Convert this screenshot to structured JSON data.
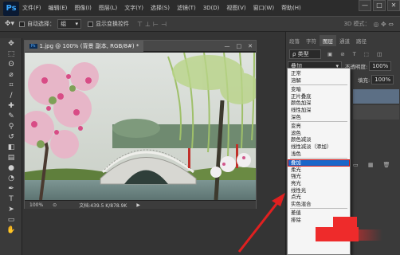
{
  "app": {
    "logo": "Ps"
  },
  "menu": [
    "文件(F)",
    "编辑(E)",
    "图像(I)",
    "图层(L)",
    "文字(Y)",
    "选择(S)",
    "滤镜(T)",
    "3D(D)",
    "视图(V)",
    "窗口(W)",
    "帮助(H)"
  ],
  "window_buttons": [
    "—",
    "□",
    "✕"
  ],
  "options": {
    "auto_select_label": "自动选择：",
    "auto_select_value": "组",
    "show_transform_label": "显示变换控件",
    "mode_3d": "3D 模式："
  },
  "document": {
    "tab_label": "1.jpg @ 100% (背景 副本, RGB/8#) *",
    "zoom": "100%",
    "doc_size": "文档:439.5 K/878.9K"
  },
  "panels": {
    "tabs": [
      "段落",
      "字符",
      "图层",
      "通道",
      "路径"
    ],
    "active_tab": "图层",
    "kind_label": "ρ 类型",
    "blend_current": "叠加",
    "opacity_label": "不透明度:",
    "opacity_value": "100%",
    "fill_label": "填充:",
    "fill_value": "100%"
  },
  "blend_groups": [
    [
      "正常",
      "溶解"
    ],
    [
      "变暗",
      "正片叠底",
      "颜色加深",
      "线性加深",
      "深色"
    ],
    [
      "变亮",
      "滤色",
      "颜色减淡",
      "线性减淡（添加）",
      "浅色"
    ],
    [
      "叠加",
      "柔光",
      "强光",
      "亮光",
      "线性光",
      "点光",
      "实色混合"
    ],
    [
      "差值",
      "排除"
    ]
  ],
  "colors": {
    "accent": "#1a66c9",
    "highlight": "#d61a1a",
    "arrow": "#e02020"
  }
}
